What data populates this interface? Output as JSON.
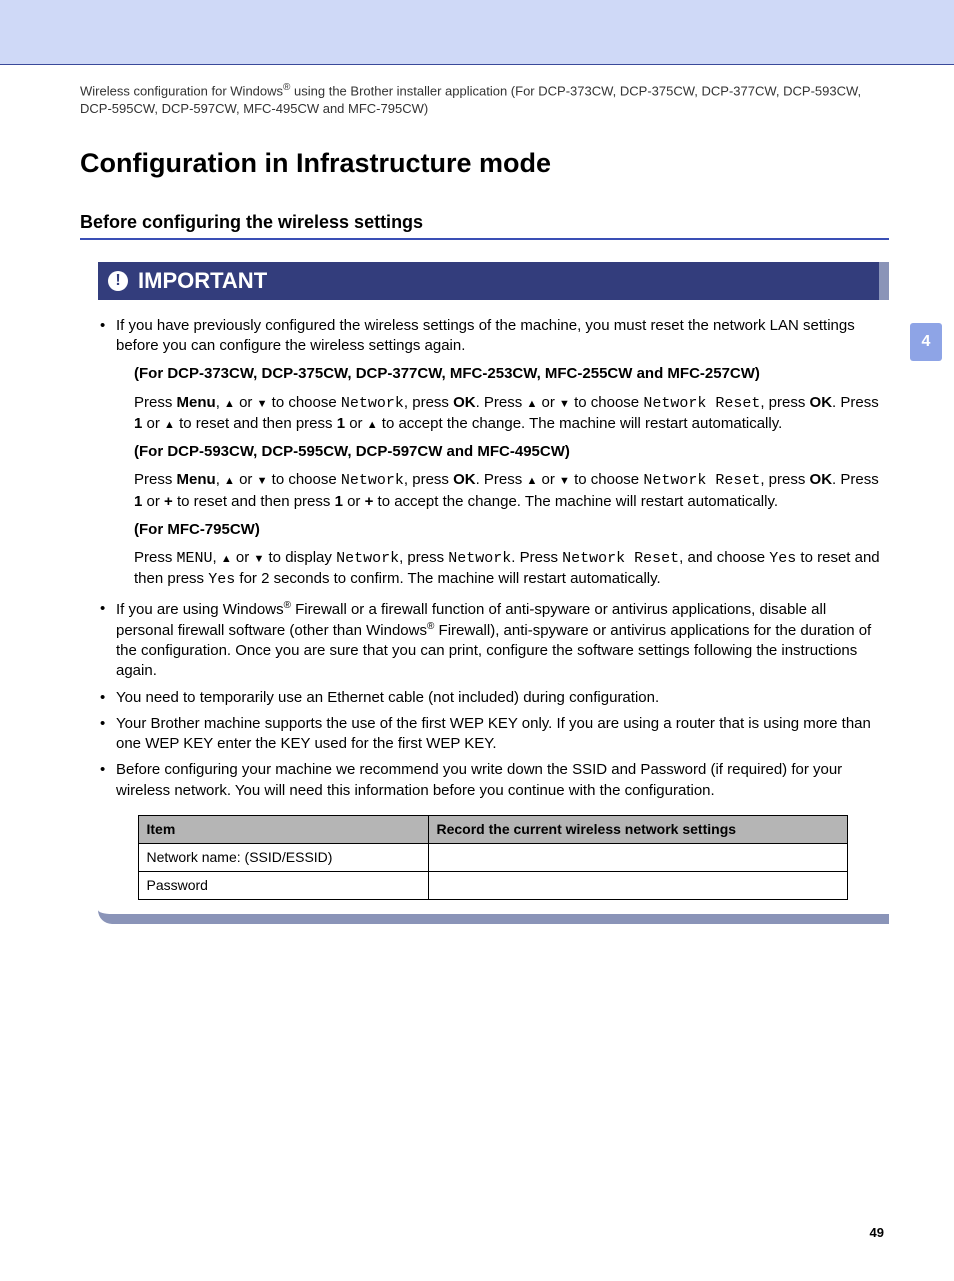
{
  "headerDesc": {
    "pre": "Wireless configuration for Windows",
    "sup": "®",
    "post": " using the Brother installer application (For DCP-373CW, DCP-375CW, DCP-377CW, DCP-593CW, DCP-595CW, DCP-597CW, MFC-495CW and MFC-795CW)"
  },
  "title": "Configuration in Infrastructure mode",
  "subheading": "Before configuring the wireless settings",
  "sideTab": "4",
  "importantLabel": "IMPORTANT",
  "bullet1_intro": "If you have previously configured the wireless settings of the machine, you must reset the network LAN settings before you can configure the wireless settings again.",
  "models1": "(For DCP-373CW, DCP-375CW, DCP-377CW, MFC-253CW, MFC-255CW and MFC-257CW)",
  "models2": "(For DCP-593CW, DCP-595CW, DCP-597CW and MFC-495CW)",
  "models3": "(For MFC-795CW)",
  "press": "Press ",
  "menu_bold": "Menu",
  "menu_mono": "MENU",
  "sep_comma": ", ",
  "toChoose": " to choose ",
  "toDisplay": " to display ",
  "network_mono": "Network",
  "pressWord": ", press ",
  "ok_bold": "OK",
  "period_press": ". Press ",
  "netreset_mono": "Network Reset",
  "period": ". ",
  "one_bold": "1",
  "or_word": " or ",
  "plus_bold": "+",
  "reset_then": " to reset and then press ",
  "accept_tail": " to accept the change. The machine will restart automatically.",
  "mfc795_a": ". Press ",
  "mfc795_b": ", and choose ",
  "yes_mono": "Yes",
  "mfc795_c": " to reset and then press ",
  "mfc795_d": " for 2 seconds to confirm. The machine will restart automatically.",
  "bullet2": {
    "a": "If you are using Windows",
    "sup": "®",
    "b": " Firewall or a firewall function of anti-spyware or antivirus applications, disable all personal firewall software (other than Windows",
    "sup2": "®",
    "c": " Firewall), anti-spyware or antivirus applications for the duration of the configuration. Once you are sure that you can print, configure the software settings following the instructions again."
  },
  "bullet3": "You need to temporarily use an Ethernet cable (not included) during configuration.",
  "bullet4": "Your Brother machine supports the use of the first WEP KEY only. If you are using a router that is using more than one WEP KEY enter the KEY used for the first WEP KEY.",
  "bullet5": "Before configuring your machine we recommend you write down the SSID and Password (if required) for your wireless network. You will need this information before you continue with the configuration.",
  "table": {
    "h1": "Item",
    "h2": "Record the current wireless network settings",
    "r1": "Network name: (SSID/ESSID)",
    "r2": "Password"
  },
  "pageNumber": "49",
  "glyphUp": "▲",
  "glyphDown": "▼"
}
